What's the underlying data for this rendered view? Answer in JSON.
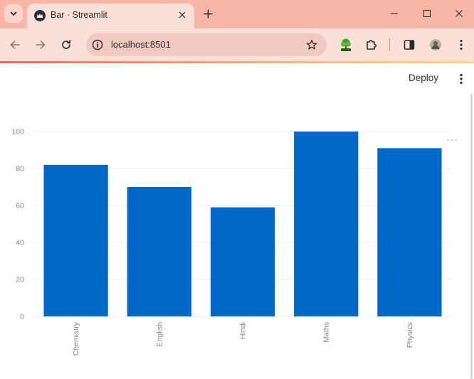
{
  "browser": {
    "tab_title": "Bar · Streamlit",
    "url": "localhost:8501",
    "icons": {
      "tab_search": "chevron-down-icon",
      "favicon": "streamlit-crown-icon",
      "tab_close": "close-icon",
      "new_tab": "plus-icon",
      "minimize": "minimize-icon",
      "maximize": "maximize-icon",
      "close_window": "close-icon",
      "back": "arrow-left-icon",
      "forward": "arrow-right-icon",
      "reload": "reload-icon",
      "site_info": "info-icon",
      "bookmark": "star-icon",
      "html_extension": "tree-icon",
      "extensions": "puzzle-icon",
      "side_panel": "side-panel-icon",
      "profile": "avatar-icon",
      "browser_menu": "kebab-menu-icon"
    },
    "colors": {
      "tabstrip": "#f7b6a6",
      "toolbar": "#fbe0da",
      "omnibox": "#f0c9c0"
    }
  },
  "app": {
    "deploy_label": "Deploy",
    "menu_icon": "kebab-menu-icon",
    "chart_menu_icon": "more-horizontal-icon"
  },
  "chart_data": {
    "type": "bar",
    "categories": [
      "Chemistry",
      "English",
      "Hindi",
      "Maths",
      "Physics"
    ],
    "values": [
      82,
      70,
      59,
      100,
      91
    ],
    "title": "",
    "xlabel": "",
    "ylabel": "",
    "ylim": [
      0,
      100
    ],
    "yticks": [
      0,
      20,
      40,
      60,
      80,
      100
    ],
    "grid": true,
    "bar_color": "#0068c9",
    "x_label_rotation": "vertical"
  }
}
